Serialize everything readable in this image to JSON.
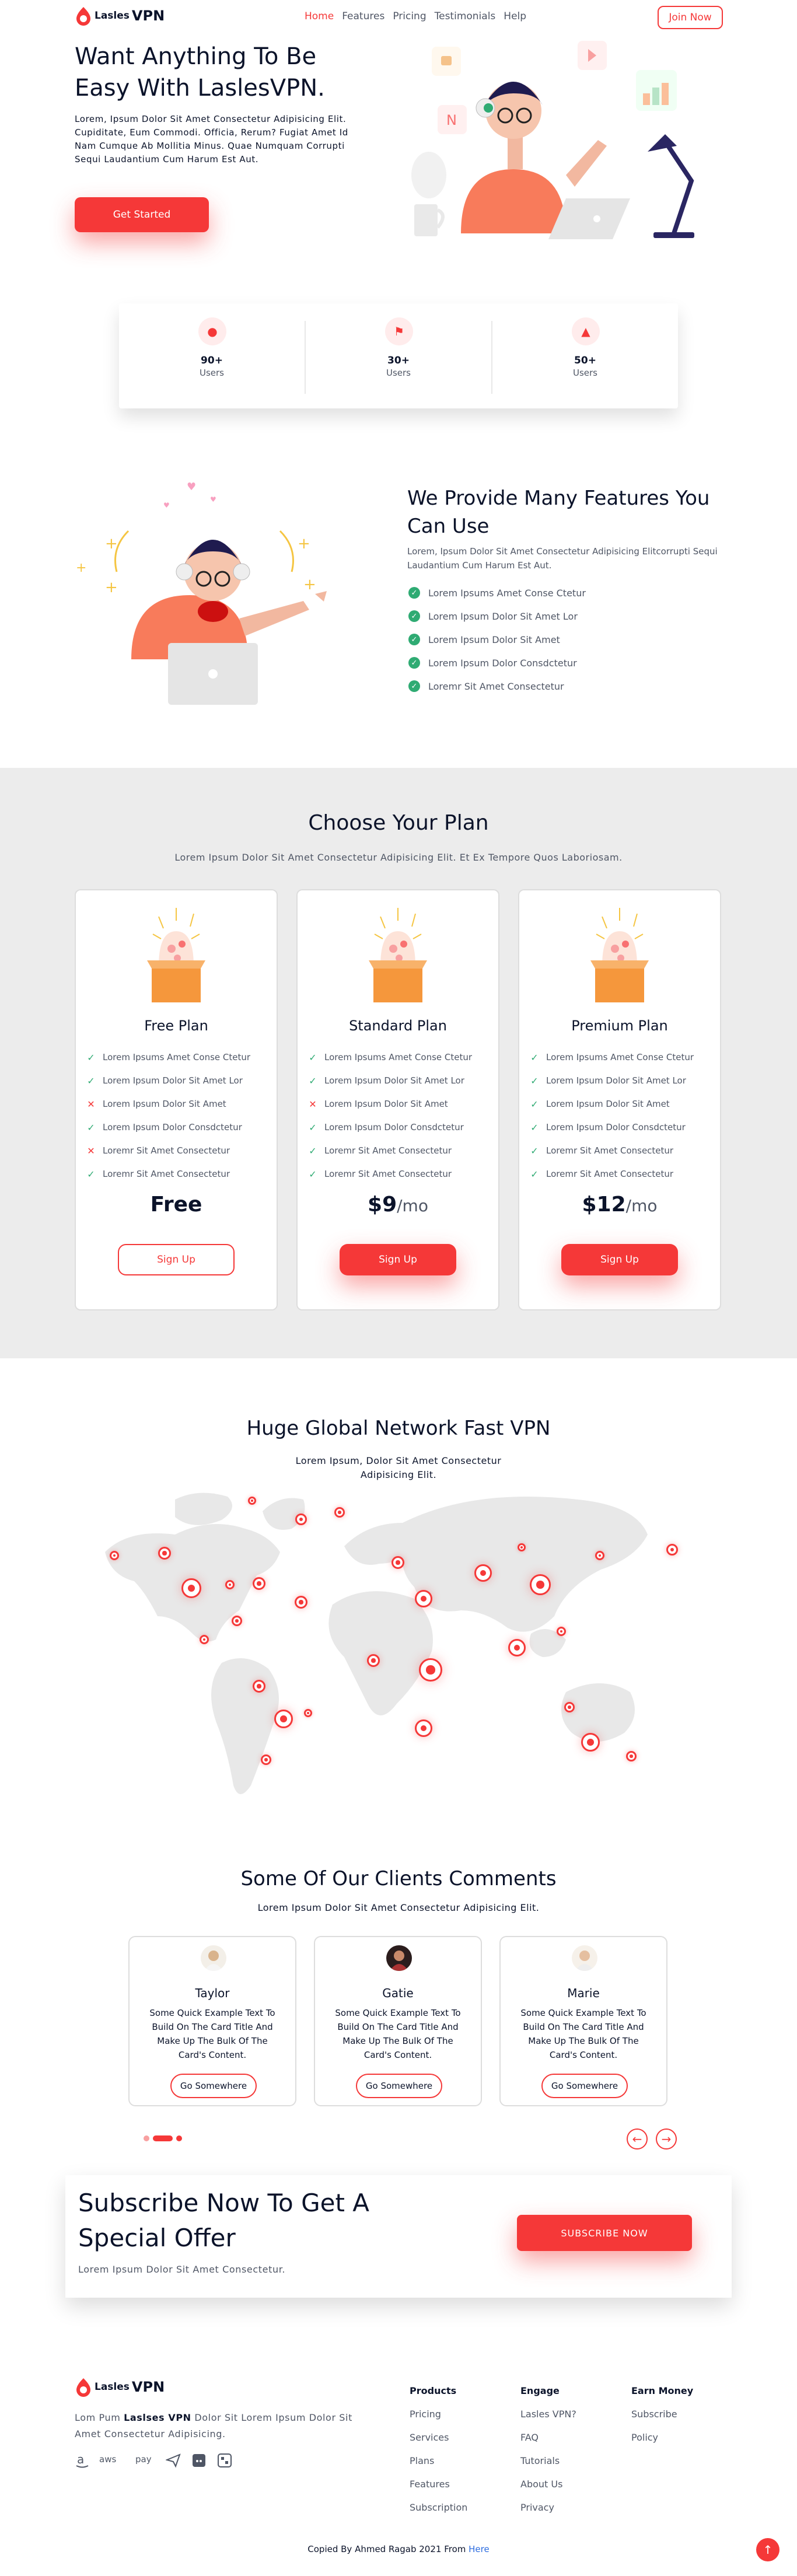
{
  "brand": {
    "name_light": "Lasles",
    "name_bold": "VPN",
    "accent": "#f53838",
    "green": "#2fab73"
  },
  "nav": {
    "links": [
      "Home",
      "Features",
      "Pricing",
      "Testimonials",
      "Help"
    ],
    "join": "Join Now"
  },
  "hero": {
    "title": "Want Anything To Be Easy With LaslesVPN.",
    "text": "Lorem, Ipsum Dolor Sit Amet Consectetur Adipisicing Elit. Cupiditate, Eum Commodi. Officia, Rerum? Fugiat Amet Id Nam Cumque Ab Mollitia Minus. Quae Numquam Corrupti Sequi Laudantium Cum Harum Est Aut.",
    "cta": "Get Started"
  },
  "stats": [
    {
      "value": "90+",
      "label": "Users",
      "icon": "user-icon"
    },
    {
      "value": "30+",
      "label": "Users",
      "icon": "location-icon"
    },
    {
      "value": "50+",
      "label": "Users",
      "icon": "server-icon"
    }
  ],
  "features": {
    "title": "We Provide Many Features You Can Use",
    "text": "Lorem, Ipsum Dolor Sit Amet Consectetur Adipisicing Elitcorrupti Sequi Laudantium Cum Harum Est Aut.",
    "items": [
      "Lorem Ipsums Amet Conse Ctetur",
      "Lorem Ipsum Dolor Sit Amet Lor",
      "Lorem Ipsum Dolor Sit Amet",
      "Lorem Ipsum Dolor Consdctetur",
      "Loremr Sit Amet Consectetur"
    ]
  },
  "plans": {
    "title": "Choose Your Plan",
    "sub": "Lorem Ipsum Dolor Sit Amet Consectetur Adipisicing Elit. Et Ex Tempore Quos Laboriosam.",
    "list": [
      {
        "name": "Free Plan",
        "features": [
          {
            "text": "Lorem Ipsums Amet Conse Ctetur",
            "ok": true
          },
          {
            "text": "Lorem Ipsum Dolor Sit Amet Lor",
            "ok": true
          },
          {
            "text": "Lorem Ipsum Dolor Sit Amet",
            "ok": false
          },
          {
            "text": "Lorem Ipsum Dolor Consdctetur",
            "ok": true
          },
          {
            "text": "Loremr Sit Amet Consectetur",
            "ok": false
          },
          {
            "text": "Loremr Sit Amet Consectetur",
            "ok": true
          }
        ],
        "price": "Free",
        "per": "",
        "button": "Sign Up",
        "button_style": "outline"
      },
      {
        "name": "Standard Plan",
        "features": [
          {
            "text": "Lorem Ipsums Amet Conse Ctetur",
            "ok": true
          },
          {
            "text": "Lorem Ipsum Dolor Sit Amet Lor",
            "ok": true
          },
          {
            "text": "Lorem Ipsum Dolor Sit Amet",
            "ok": false
          },
          {
            "text": "Lorem Ipsum Dolor Consdctetur",
            "ok": true
          },
          {
            "text": "Loremr Sit Amet Consectetur",
            "ok": true
          },
          {
            "text": "Loremr Sit Amet Consectetur",
            "ok": true
          }
        ],
        "price": "$9",
        "per": "/mo",
        "button": "Sign Up",
        "button_style": "solid"
      },
      {
        "name": "Premium Plan",
        "features": [
          {
            "text": "Lorem Ipsums Amet Conse Ctetur",
            "ok": true
          },
          {
            "text": "Lorem Ipsum Dolor Sit Amet Lor",
            "ok": true
          },
          {
            "text": "Lorem Ipsum Dolor Sit Amet",
            "ok": true
          },
          {
            "text": "Lorem Ipsum Dolor Consdctetur",
            "ok": true
          },
          {
            "text": "Loremr Sit Amet Consectetur",
            "ok": true
          },
          {
            "text": "Loremr Sit Amet Consectetur",
            "ok": true
          }
        ],
        "price": "$12",
        "per": "/mo",
        "button": "Sign Up",
        "button_style": "solid"
      }
    ]
  },
  "network": {
    "title": "Huge Global Network Fast VPN",
    "sub_line1": "Lorem Ipsum, Dolor Sit Amet Consectetur",
    "sub_line2": "Adipisicing Elit."
  },
  "clients": {
    "title": "Some Of Our Clients Comments",
    "sub": "Lorem Ipsum Dolor Sit Amet Consectetur Adipisicing Elit.",
    "cards": [
      {
        "name": "Taylor",
        "text": "Some Quick Example Text To Build On The Card Title And Make Up The Bulk Of The Card's Content.",
        "button": "Go Somewhere"
      },
      {
        "name": "Gatie",
        "text": "Some Quick Example Text To Build On The Card Title And Make Up The Bulk Of The Card's Content.",
        "button": "Go Somewhere"
      },
      {
        "name": "Marie",
        "text": "Some Quick Example Text To Build On The Card Title And Make Up The Bulk Of The Card's Content.",
        "button": "Go Somewhere"
      }
    ]
  },
  "subscribe": {
    "title": "Subscribe Now To Get A Special Offer",
    "text": "Lorem Ipsum Dolor Sit Amet Consectetur.",
    "button": "SUBSCRIBE NOW"
  },
  "footer": {
    "text_pre": "Lom Pum ",
    "text_brand": "Laslses VPN",
    "text_post": " Dolor Sit Lorem Ipsum Dolor Sit Amet Consectetur Adipisicing.",
    "social": [
      "amazon-icon",
      "aws-icon",
      "pay-icon",
      "paper-plane-icon",
      "discord-icon",
      "dashboard-icon"
    ],
    "social_text": {
      "aws": "aws",
      "pay": "pay"
    },
    "columns": [
      {
        "head": "Products",
        "links": [
          "Pricing",
          "Services",
          "Plans",
          "Features",
          "Subscription"
        ]
      },
      {
        "head": "Engage",
        "links": [
          "Lasles VPN?",
          "FAQ",
          "Tutorials",
          "About Us",
          "Privacy"
        ]
      },
      {
        "head": "Earn Money",
        "links": [
          "Subscribe",
          "Policy"
        ]
      }
    ],
    "copy_pre": "Copied By Ahmed Ragab 2021 From ",
    "copy_link": "Here"
  }
}
